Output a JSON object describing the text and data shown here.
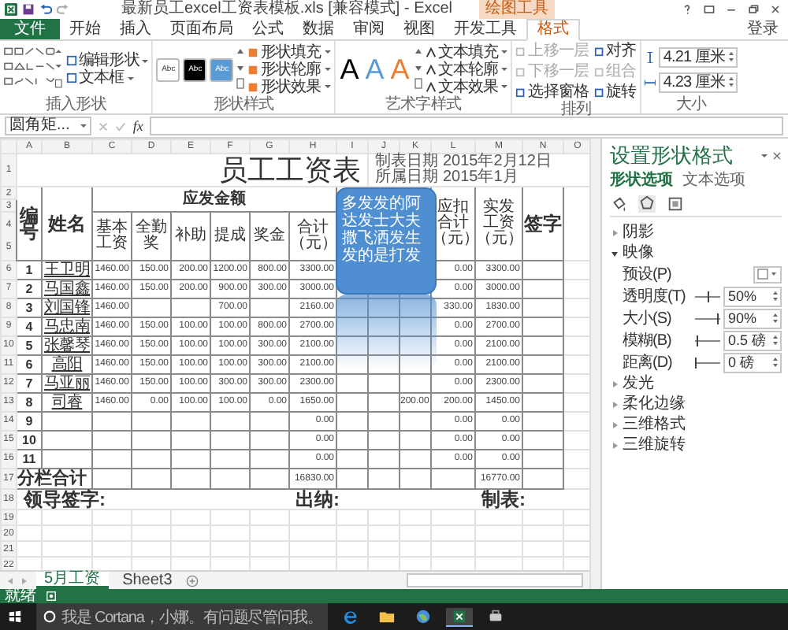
{
  "window": {
    "title": "最新员工excel工资表模板.xls [兼容模式] - Excel",
    "context_tab": "绘图工具",
    "sign_in": "登录"
  },
  "ribbon_tabs": [
    {
      "label": "文件",
      "kind": "file",
      "selected": false
    },
    {
      "label": "开始",
      "kind": "tab",
      "selected": false
    },
    {
      "label": "插入",
      "kind": "tab",
      "selected": false
    },
    {
      "label": "页面布局",
      "kind": "tab",
      "selected": false
    },
    {
      "label": "公式",
      "kind": "tab",
      "selected": false
    },
    {
      "label": "数据",
      "kind": "tab",
      "selected": false
    },
    {
      "label": "审阅",
      "kind": "tab",
      "selected": false
    },
    {
      "label": "视图",
      "kind": "tab",
      "selected": false
    },
    {
      "label": "开发工具",
      "kind": "tab",
      "selected": false
    },
    {
      "label": "格式",
      "kind": "tab",
      "selected": true
    }
  ],
  "ribbon": {
    "insert_shapes": {
      "label": "插入形状",
      "buttons": [
        "编辑形状",
        "文本框"
      ]
    },
    "shape_styles": {
      "label": "形状样式",
      "swatches": [
        {
          "label": "Abc",
          "color": "#ffffff"
        },
        {
          "label": "Abc",
          "color": "#000000"
        },
        {
          "label": "Abc",
          "color": "#5b9bd5"
        }
      ],
      "buttons": [
        "形状填充",
        "形状轮廓",
        "形状效果"
      ]
    },
    "wordart_styles": {
      "label": "艺术字样式",
      "samples": [
        {
          "label": "A",
          "color": "#000000"
        },
        {
          "label": "A",
          "color": "#5b9bd5"
        },
        {
          "label": "A",
          "color": "#ed7d31"
        }
      ],
      "buttons": [
        "文本填充",
        "文本轮廓",
        "文本效果"
      ]
    },
    "arrange": {
      "label": "排列",
      "buttons": [
        {
          "label": "上移一层",
          "disabled": true
        },
        {
          "label": "下移一层",
          "disabled": true
        },
        {
          "label": "选择窗格",
          "disabled": false
        },
        {
          "label": "对齐",
          "disabled": false
        },
        {
          "label": "组合",
          "disabled": true
        },
        {
          "label": "旋转",
          "disabled": false
        }
      ]
    },
    "size": {
      "label": "大小",
      "fields": [
        "4.21 厘米",
        "4.23 厘米"
      ]
    }
  },
  "formula_bar": {
    "name_box": "圆角矩...",
    "fx": "fx"
  },
  "sheet": {
    "column_letters": [
      "A",
      "B",
      "C",
      "D",
      "E",
      "F",
      "G",
      "H",
      "I",
      "J",
      "K",
      "L",
      "M",
      "N",
      "O"
    ],
    "title_row_number": "1",
    "title": "员工工资表",
    "date_label": "制表日期",
    "date": "2015年2月12日",
    "period_label": "所属日期",
    "period": "2015年1月",
    "header_row_numbers": [
      "2",
      "3",
      "4",
      "5"
    ],
    "headers": {
      "no": "编号",
      "name": "姓名",
      "group": "应发金额",
      "basic": "基本工资",
      "attendance": "全勤奖",
      "allowance": "补助",
      "commission": "提成",
      "bonus": "奖金",
      "total": "合计（元）",
      "deductions": "应扣合计（元）",
      "net": "实发工资（元）",
      "signature": "签字"
    },
    "rows": [
      {
        "row_number": "6",
        "no": "1",
        "name": "王卫明",
        "values": {
          "basic": "1460.00",
          "attendance": "150.00",
          "allowance": "200.00",
          "commission": "1200.00",
          "bonus": "800.00",
          "total": "3300.00",
          "deductions": "0.00",
          "net": "3300.00"
        }
      },
      {
        "row_number": "7",
        "no": "2",
        "name": "马国鑫",
        "values": {
          "basic": "1460.00",
          "attendance": "150.00",
          "allowance": "200.00",
          "commission": "900.00",
          "bonus": "300.00",
          "total": "3000.00",
          "deductions": "0.00",
          "net": "3000.00"
        }
      },
      {
        "row_number": "8",
        "no": "3",
        "name": "刘国锋",
        "values": {
          "basic": "1460.00",
          "commission": "700.00",
          "total": "2160.00",
          "deductions": "330.00",
          "net": "1830.00"
        }
      },
      {
        "row_number": "9",
        "no": "4",
        "name": "马忠南",
        "values": {
          "basic": "1460.00",
          "attendance": "150.00",
          "allowance": "100.00",
          "commission": "100.00",
          "bonus": "800.00",
          "total": "2700.00",
          "deductions": "0.00",
          "net": "2700.00"
        }
      },
      {
        "row_number": "10",
        "no": "5",
        "name": "张馨琴",
        "values": {
          "basic": "1460.00",
          "attendance": "150.00",
          "allowance": "100.00",
          "commission": "100.00",
          "bonus": "300.00",
          "total": "2100.00",
          "deductions": "0.00",
          "net": "2100.00"
        }
      },
      {
        "row_number": "11",
        "no": "6",
        "name": "高阳",
        "values": {
          "basic": "1460.00",
          "attendance": "150.00",
          "allowance": "100.00",
          "commission": "100.00",
          "bonus": "300.00",
          "total": "2100.00",
          "deductions": "0.00",
          "net": "2100.00"
        }
      },
      {
        "row_number": "12",
        "no": "7",
        "name": "马亚丽",
        "values": {
          "basic": "1460.00",
          "attendance": "150.00",
          "allowance": "100.00",
          "commission": "300.00",
          "bonus": "300.00",
          "total": "2300.00",
          "deductions": "0.00",
          "net": "2300.00"
        }
      },
      {
        "row_number": "13",
        "no": "8",
        "name": "司睿",
        "values": {
          "basic": "1460.00",
          "attendance": "0.00",
          "allowance": "100.00",
          "commission": "100.00",
          "bonus": "0.00",
          "total": "1650.00",
          "col_k": "200.00",
          "deductions": "200.00",
          "net": "1450.00"
        }
      },
      {
        "row_number": "14",
        "no": "9",
        "values": {
          "total": "0.00",
          "deductions": "0.00",
          "net": "0.00"
        }
      },
      {
        "row_number": "15",
        "no": "10",
        "values": {
          "total": "0.00",
          "deductions": "0.00",
          "net": "0.00"
        }
      },
      {
        "row_number": "16",
        "no": "11",
        "values": {
          "total": "0.00",
          "deductions": "0.00",
          "net": "0.00"
        }
      }
    ],
    "total_row": {
      "row_number": "17",
      "label": "分栏合计",
      "values": {
        "total": "16830.00",
        "net": "16770.00"
      }
    },
    "footer_row": {
      "row_number": "18",
      "leader": "领导签字:",
      "cashier": "出纳:",
      "preparer": "制表:"
    },
    "empty_row_numbers": [
      "19",
      "20",
      "21",
      "22"
    ],
    "shape": {
      "text": "多发发的阿达发士大夫撒飞洒发生发的是打发"
    }
  },
  "format_pane": {
    "title": "设置形状格式",
    "tabs": [
      {
        "label": "形状选项",
        "selected": true
      },
      {
        "label": "文本选项",
        "selected": false
      }
    ],
    "sections": [
      {
        "label": "阴影",
        "expanded": false
      },
      {
        "label": "映像",
        "expanded": true,
        "settings": [
          {
            "kind": "preset",
            "label": "预设(P)"
          },
          {
            "kind": "slider",
            "label": "透明度(T)",
            "level": 0.5,
            "value": "50%"
          },
          {
            "kind": "slider",
            "label": "大小(S)",
            "level": 0.9,
            "value": "90%"
          },
          {
            "kind": "slider",
            "label": "模糊(B)",
            "level": 0.05,
            "value": "0.5 磅"
          },
          {
            "kind": "slider",
            "label": "距离(D)",
            "level": 0,
            "value": "0 磅"
          }
        ]
      },
      {
        "label": "发光",
        "expanded": false
      },
      {
        "label": "柔化边缘",
        "expanded": false
      },
      {
        "label": "三维格式",
        "expanded": false
      },
      {
        "label": "三维旋转",
        "expanded": false
      }
    ]
  },
  "sheet_tabs": [
    {
      "label": "5月工资",
      "selected": true
    },
    {
      "label": "Sheet3",
      "selected": false
    }
  ],
  "status_bar": {
    "text": "就绪"
  },
  "taskbar": {
    "search_placeholder": "我是 Cortana，小娜。有问题尽管问我。"
  }
}
